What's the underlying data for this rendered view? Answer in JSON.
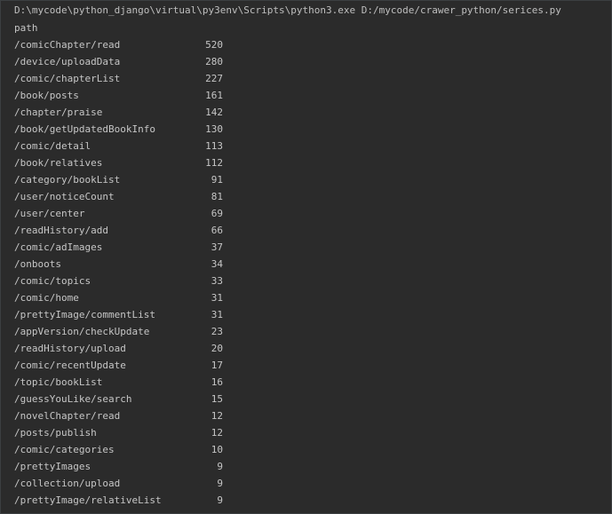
{
  "console": {
    "command": "D:\\mycode\\python_django\\virtual\\py3env\\Scripts\\python3.exe D:/mycode/crawer_python/serices.py",
    "header": "path",
    "rows": [
      {
        "path": "/comicChapter/read",
        "count": "520"
      },
      {
        "path": "/device/uploadData",
        "count": "280"
      },
      {
        "path": "/comic/chapterList",
        "count": "227"
      },
      {
        "path": "/book/posts",
        "count": "161"
      },
      {
        "path": "/chapter/praise",
        "count": "142"
      },
      {
        "path": "/book/getUpdatedBookInfo",
        "count": "130"
      },
      {
        "path": "/comic/detail",
        "count": "113"
      },
      {
        "path": "/book/relatives",
        "count": "112"
      },
      {
        "path": "/category/bookList",
        "count": "91"
      },
      {
        "path": "/user/noticeCount",
        "count": "81"
      },
      {
        "path": "/user/center",
        "count": "69"
      },
      {
        "path": "/readHistory/add",
        "count": "66"
      },
      {
        "path": "/comic/adImages",
        "count": "37"
      },
      {
        "path": "/onboots",
        "count": "34"
      },
      {
        "path": "/comic/topics",
        "count": "33"
      },
      {
        "path": "/comic/home",
        "count": "31"
      },
      {
        "path": "/prettyImage/commentList",
        "count": "31"
      },
      {
        "path": "/appVersion/checkUpdate",
        "count": "23"
      },
      {
        "path": "/readHistory/upload",
        "count": "20"
      },
      {
        "path": "/comic/recentUpdate",
        "count": "17"
      },
      {
        "path": "/topic/bookList",
        "count": "16"
      },
      {
        "path": "/guessYouLike/search",
        "count": "15"
      },
      {
        "path": "/novelChapter/read",
        "count": "12"
      },
      {
        "path": "/posts/publish",
        "count": "12"
      },
      {
        "path": "/comic/categories",
        "count": "10"
      },
      {
        "path": "/prettyImages",
        "count": "9"
      },
      {
        "path": "/collection/upload",
        "count": "9"
      },
      {
        "path": "/prettyImage/relativeList",
        "count": "9"
      }
    ]
  }
}
